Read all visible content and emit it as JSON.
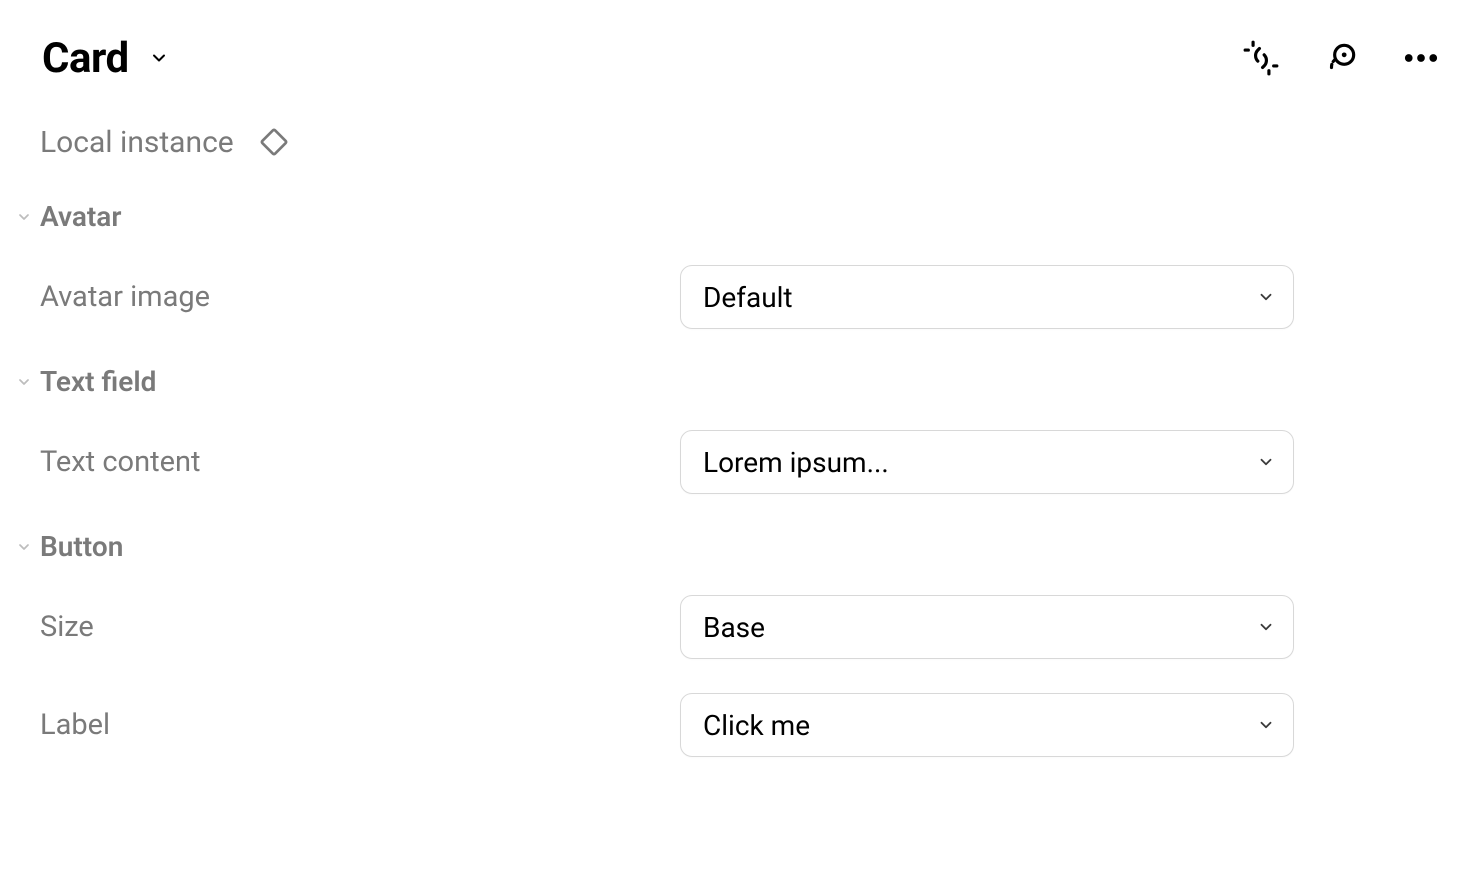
{
  "header": {
    "title": "Card"
  },
  "local_instance_label": "Local instance",
  "sections": {
    "avatar": {
      "title": "Avatar",
      "image_label": "Avatar image",
      "image_value": "Default"
    },
    "text_field": {
      "title": "Text field",
      "content_label": "Text content",
      "content_value": "Lorem ipsum..."
    },
    "button": {
      "title": "Button",
      "size_label": "Size",
      "size_value": "Base",
      "label_label": "Label",
      "label_value": "Click me"
    }
  }
}
